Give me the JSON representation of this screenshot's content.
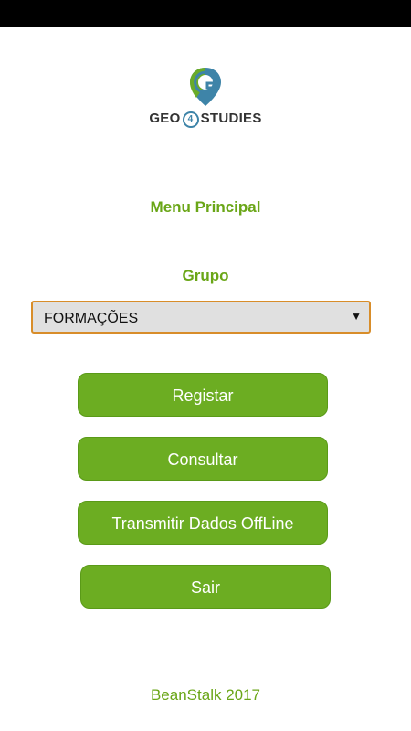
{
  "logo": {
    "brand_left": "GEO",
    "brand_digit": "4",
    "brand_right": "STUDIES",
    "pin_icon": "map-pin-g-icon",
    "colors": {
      "pin_green": "#6cad22",
      "pin_blue": "#3e84a8",
      "text": "#333333"
    }
  },
  "menu": {
    "title": "Menu Principal"
  },
  "group": {
    "label": "Grupo",
    "selected": "FORMAÇÕES",
    "arrow_icon": "dropdown-arrow-icon"
  },
  "buttons": {
    "register": "Registar",
    "consult": "Consultar",
    "transmit": "Transmitir Dados OffLine",
    "exit": "Sair"
  },
  "footer": {
    "text": "BeanStalk 2017"
  },
  "colors": {
    "accent": "#6aa617",
    "button": "#6cad22",
    "select_border": "#d88d2a",
    "select_bg": "#e0e0e0",
    "status_bar": "#000000"
  }
}
